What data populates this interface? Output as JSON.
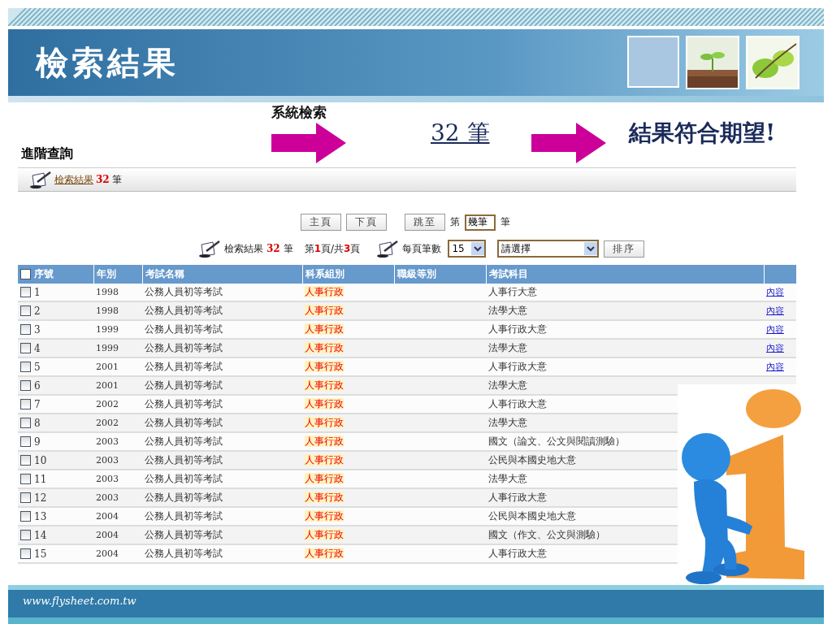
{
  "slide": {
    "title": "檢索結果",
    "footer": "www.flysheet.com.tw"
  },
  "flow": {
    "caption": "系統檢索",
    "count": "32 筆",
    "result": "結果符合期望!"
  },
  "page": {
    "heading": "進階查詢",
    "breadcrumb": {
      "link": "檢索結果",
      "count": "32",
      "unit": "筆"
    },
    "pager": {
      "buttons": [
        "主頁",
        "下頁"
      ],
      "jump_button": "跳至",
      "prefix": "第",
      "jump_value": "幾筆",
      "suffix": "筆"
    },
    "summary": {
      "label": "檢索結果",
      "count": "32",
      "unit": "筆",
      "pages": "第**1**頁/共**3**頁",
      "per_page_label": "每頁筆數",
      "per_page": "15",
      "sort_value": "請選擇",
      "sort_button": "排序"
    },
    "table": {
      "select_all_checked": false,
      "columns": [
        "序號",
        "年別",
        "考試名稱",
        "科系組別",
        "職級等別",
        "考試科目"
      ],
      "rows": [
        {
          "checked": false,
          "no": "1",
          "year": "1998",
          "exam": "公務人員初等考試",
          "dept": "人事行政",
          "subject": "人事行大意",
          "link": "內容"
        },
        {
          "checked": false,
          "no": "2",
          "year": "1998",
          "exam": "公務人員初等考試",
          "dept": "人事行政",
          "subject": "法學大意",
          "link": "內容"
        },
        {
          "checked": false,
          "no": "3",
          "year": "1999",
          "exam": "公務人員初等考試",
          "dept": "人事行政",
          "subject": "人事行政大意",
          "link": "內容"
        },
        {
          "checked": false,
          "no": "4",
          "year": "1999",
          "exam": "公務人員初等考試",
          "dept": "人事行政",
          "subject": "法學大意",
          "link": "內容"
        },
        {
          "checked": false,
          "no": "5",
          "year": "2001",
          "exam": "公務人員初等考試",
          "dept": "人事行政",
          "subject": "人事行政大意",
          "link": "內容"
        },
        {
          "checked": false,
          "no": "6",
          "year": "2001",
          "exam": "公務人員初等考試",
          "dept": "人事行政",
          "subject": "法學大意"
        },
        {
          "checked": false,
          "no": "7",
          "year": "2002",
          "exam": "公務人員初等考試",
          "dept": "人事行政",
          "subject": "人事行政大意"
        },
        {
          "checked": false,
          "no": "8",
          "year": "2002",
          "exam": "公務人員初等考試",
          "dept": "人事行政",
          "subject": "法學大意"
        },
        {
          "checked": false,
          "no": "9",
          "year": "2003",
          "exam": "公務人員初等考試",
          "dept": "人事行政",
          "subject": "國文（論文、公文與閱讀測驗）"
        },
        {
          "checked": false,
          "no": "10",
          "year": "2003",
          "exam": "公務人員初等考試",
          "dept": "人事行政",
          "subject": "公民與本國史地大意"
        },
        {
          "checked": false,
          "no": "11",
          "year": "2003",
          "exam": "公務人員初等考試",
          "dept": "人事行政",
          "subject": "法學大意"
        },
        {
          "checked": false,
          "no": "12",
          "year": "2003",
          "exam": "公務人員初等考試",
          "dept": "人事行政",
          "subject": "人事行政大意"
        },
        {
          "checked": false,
          "no": "13",
          "year": "2004",
          "exam": "公務人員初等考試",
          "dept": "人事行政",
          "subject": "公民與本國史地大意"
        },
        {
          "checked": false,
          "no": "14",
          "year": "2004",
          "exam": "公務人員初等考試",
          "dept": "人事行政",
          "subject": "國文（作文、公文與測驗）"
        },
        {
          "checked": false,
          "no": "15",
          "year": "2004",
          "exam": "公務人員初等考試",
          "dept": "人事行政",
          "subject": "人事行政大意"
        }
      ]
    }
  }
}
